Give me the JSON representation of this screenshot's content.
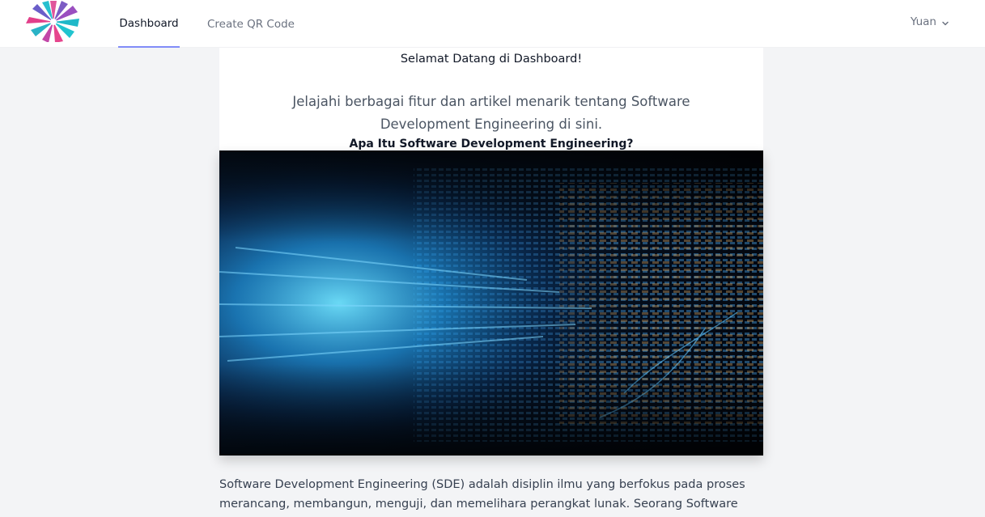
{
  "nav": {
    "logo_icon": "star-flower-logo-icon",
    "links": [
      {
        "label": "Dashboard",
        "active": true
      },
      {
        "label": "Create QR Code",
        "active": false
      }
    ],
    "user": {
      "name": "Yuan",
      "icon": "chevron-down-icon"
    },
    "accent_color": "#818cf8"
  },
  "main": {
    "welcome": "Selamat Datang di Dashboard!",
    "subtitle": "Jelajahi berbagai fitur dan artikel menarik tentang Software Development Engineering di sini.",
    "section_title": "Apa Itu Software Development Engineering?",
    "body": "Software Development Engineering (SDE) adalah disiplin ilmu yang berfokus pada proses merancang, membangun, menguji, dan memelihara perangkat lunak. Seorang Software"
  }
}
